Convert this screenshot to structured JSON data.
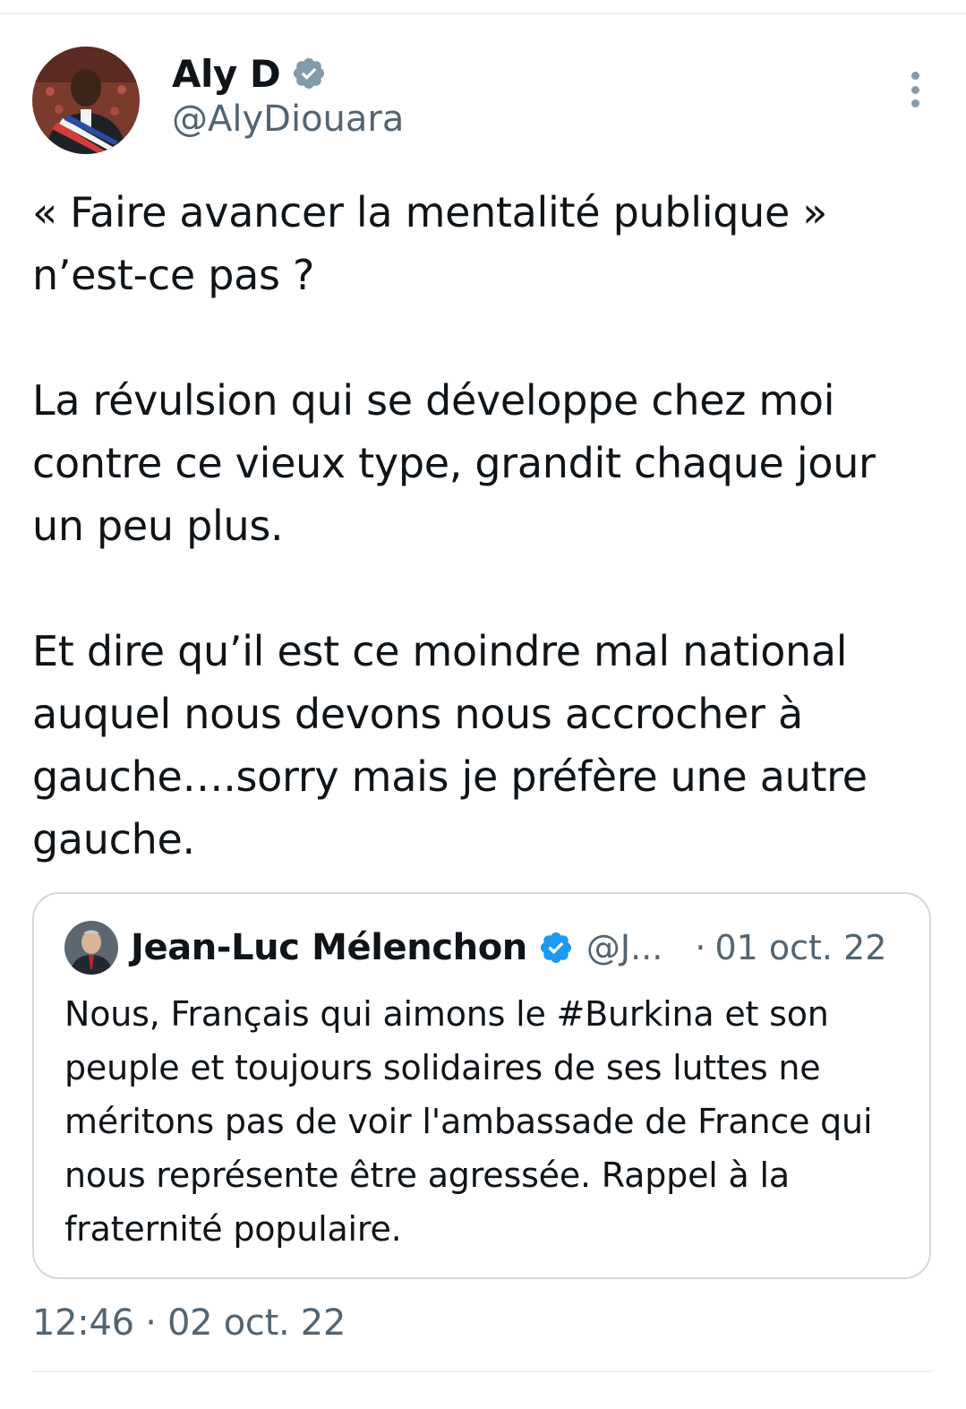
{
  "tweet": {
    "author": {
      "display_name": "Aly D",
      "handle": "@AlyDiouara",
      "verified_color": "#829aab"
    },
    "text": "« Faire avancer la mentalité publique »\nn’est-ce pas ?\n\nLa révulsion qui se développe chez moi\ncontre ce vieux type, grandit chaque jour\nun peu plus.\n\nEt dire qu’il est ce moindre mal national\nauquel nous devons nous accrocher à\ngauche….sorry mais je préfère une autre\ngauche.",
    "timestamp": "12:46 · 02 oct. 22",
    "more_icon": "more-vertical-icon"
  },
  "quoted_tweet": {
    "author": {
      "display_name": "Jean-Luc Mélenchon",
      "handle": "@J...",
      "verified_color": "#1d9bf0"
    },
    "separator": "·",
    "date": "01 oct. 22",
    "text": "Nous, Français qui aimons le #Burkina et son peuple et toujours solidaires de ses luttes ne méritons pas de voir l'ambassade de France qui nous représente être agressée. Rappel à la fraternité populaire."
  }
}
